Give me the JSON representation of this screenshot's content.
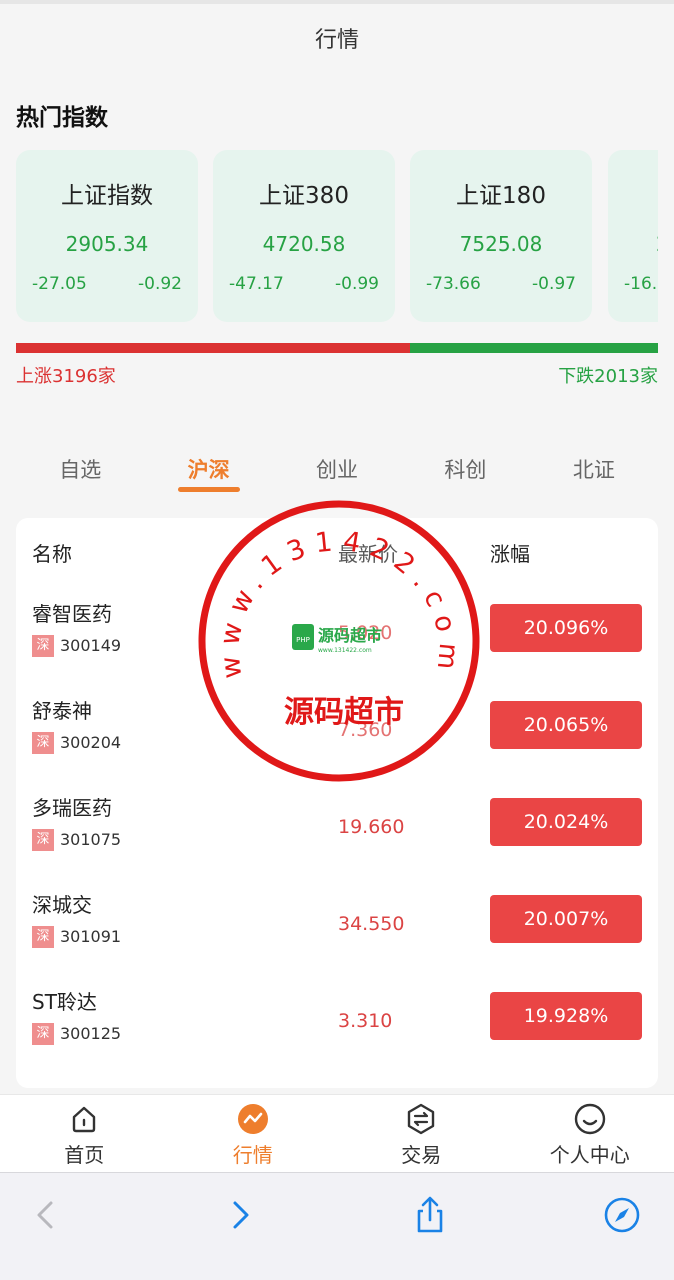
{
  "nav": {
    "title": "行情"
  },
  "hot_indices": {
    "title": "热门指数",
    "items": [
      {
        "name": "上证指数",
        "value": "2905.34",
        "change": "-27.05",
        "percent": "-0.92"
      },
      {
        "name": "上证380",
        "value": "4720.58",
        "change": "-47.17",
        "percent": "-0.99"
      },
      {
        "name": "上证180",
        "value": "7525.08",
        "change": "-73.66",
        "percent": "-0.97"
      },
      {
        "name": "",
        "value": "2",
        "change": "-16.",
        "percent": ""
      }
    ]
  },
  "breadth": {
    "up_label": "上涨3196家",
    "down_label": "下跌2013家",
    "up_count": 3196,
    "down_count": 2013,
    "up_color": "#db3232",
    "down_color": "#27a244"
  },
  "market_tabs": [
    {
      "label": "自选",
      "active": false
    },
    {
      "label": "沪深",
      "active": true
    },
    {
      "label": "创业",
      "active": false
    },
    {
      "label": "科创",
      "active": false
    },
    {
      "label": "北证",
      "active": false
    }
  ],
  "stock_table": {
    "headers": {
      "name": "名称",
      "price": "最新价",
      "change": "涨幅"
    },
    "rows": [
      {
        "name": "睿智医药",
        "market": "深",
        "code": "300149",
        "price": "5.020",
        "change": "20.096%"
      },
      {
        "name": "舒泰神",
        "market": "深",
        "code": "300204",
        "price": "7.360",
        "change": "20.065%"
      },
      {
        "name": "多瑞医药",
        "market": "深",
        "code": "301075",
        "price": "19.660",
        "change": "20.024%"
      },
      {
        "name": "深城交",
        "market": "深",
        "code": "301091",
        "price": "34.550",
        "change": "20.007%"
      },
      {
        "name": "ST聆达",
        "market": "深",
        "code": "300125",
        "price": "3.310",
        "change": "19.928%"
      }
    ]
  },
  "watermark": {
    "ring_text": "www.131422.com",
    "center_text": "源码超市",
    "logo_text": "源码超市",
    "logo_sub": "www.131422.com",
    "logo_badge": "PHP"
  },
  "tabbar": [
    {
      "label": "首页",
      "icon": "home-icon",
      "active": false
    },
    {
      "label": "行情",
      "icon": "market-chart-icon",
      "active": true
    },
    {
      "label": "交易",
      "icon": "exchange-icon",
      "active": false
    },
    {
      "label": "个人中心",
      "icon": "smile-user-icon",
      "active": false
    }
  ],
  "browser_toolbar": [
    {
      "icon": "back-chevron-icon",
      "enabled": false
    },
    {
      "icon": "forward-chevron-icon",
      "enabled": true
    },
    {
      "icon": "share-icon",
      "enabled": true
    },
    {
      "icon": "compass-icon",
      "enabled": true
    }
  ],
  "colors": {
    "accent": "#ee7e2d",
    "up_red": "#db3232",
    "down_green": "#27a244",
    "card_bg": "#e6f4ee",
    "ios_blue": "#1a82e6"
  }
}
